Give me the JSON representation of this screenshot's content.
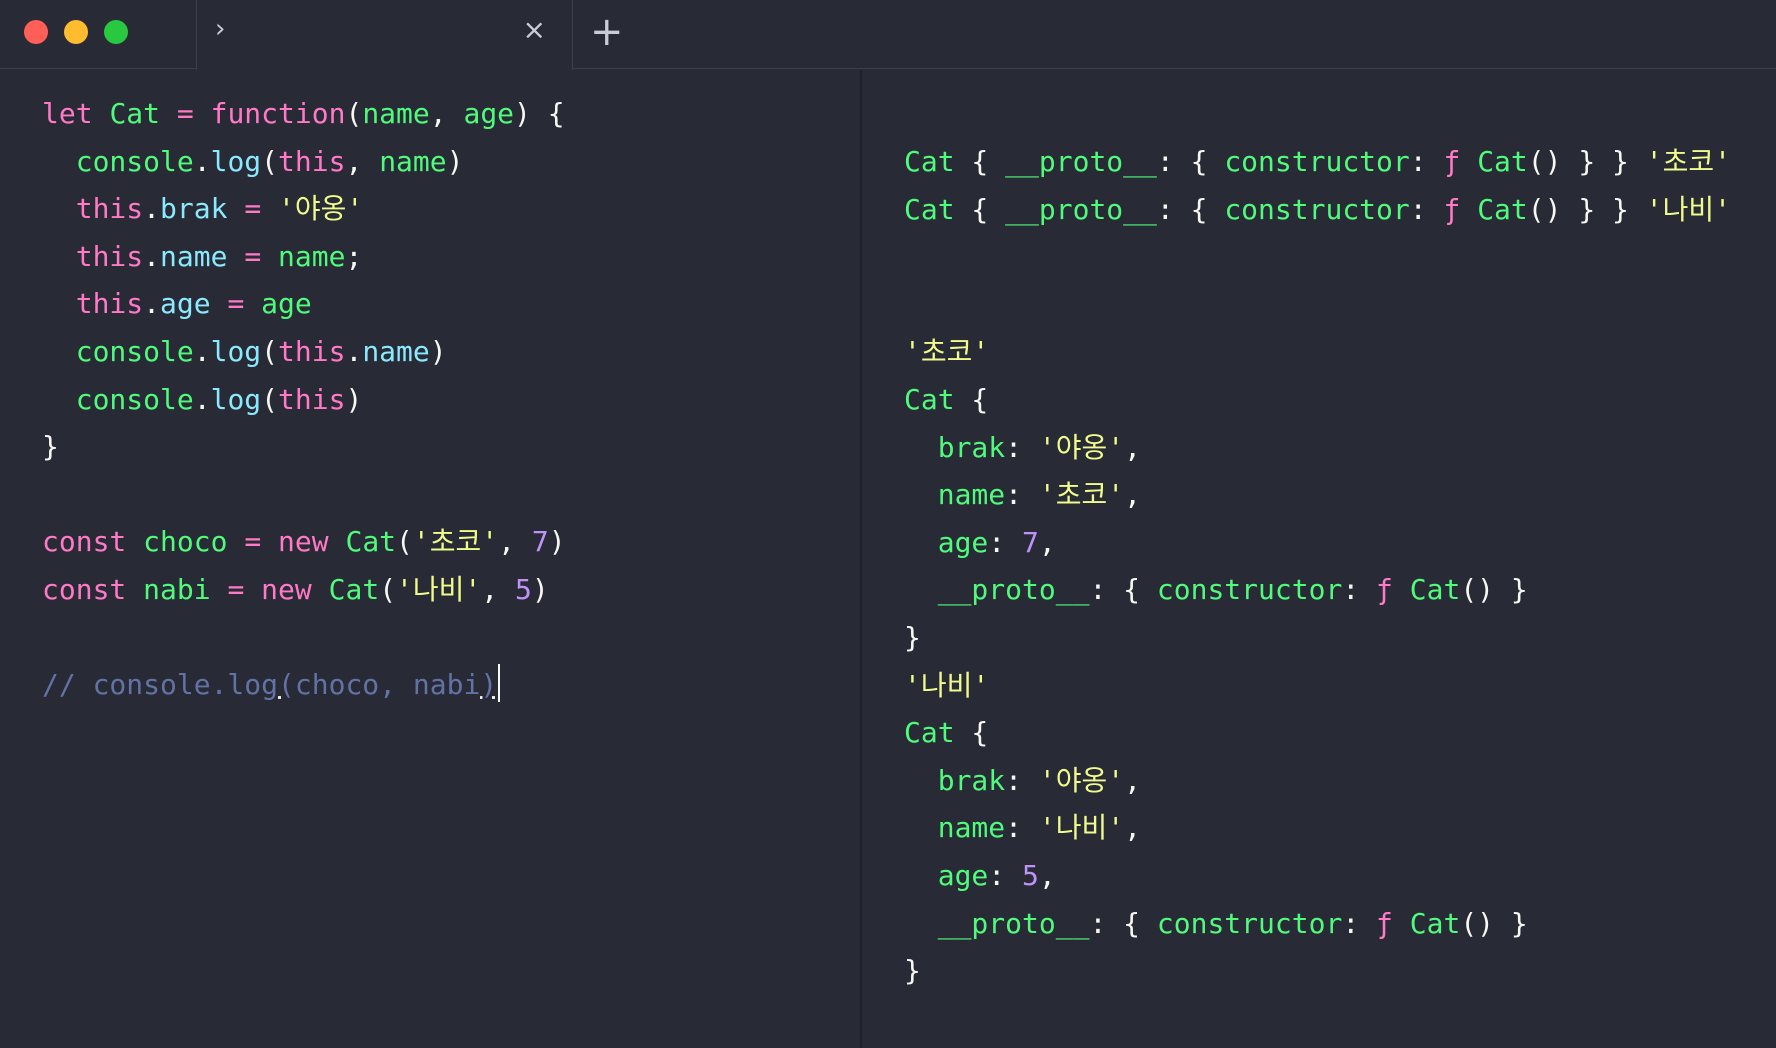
{
  "window": {
    "tab": {
      "chevron": "›",
      "close": "×"
    },
    "new_tab": "+"
  },
  "editor": {
    "lines": [
      [
        {
          "t": "let",
          "c": "k"
        },
        {
          "t": " "
        },
        {
          "t": "Cat",
          "c": "f"
        },
        {
          "t": " "
        },
        {
          "t": "=",
          "c": "k"
        },
        {
          "t": " "
        },
        {
          "t": "function",
          "c": "k"
        },
        {
          "t": "("
        },
        {
          "t": "name",
          "c": "f"
        },
        {
          "t": ", "
        },
        {
          "t": "age",
          "c": "f"
        },
        {
          "t": ") {"
        }
      ],
      [
        {
          "t": "  "
        },
        {
          "t": "console",
          "c": "f"
        },
        {
          "t": "."
        },
        {
          "t": "log",
          "c": "p"
        },
        {
          "t": "("
        },
        {
          "t": "this",
          "c": "k"
        },
        {
          "t": ", "
        },
        {
          "t": "name",
          "c": "f"
        },
        {
          "t": ")"
        }
      ],
      [
        {
          "t": "  "
        },
        {
          "t": "this",
          "c": "k"
        },
        {
          "t": "."
        },
        {
          "t": "brak",
          "c": "p"
        },
        {
          "t": " "
        },
        {
          "t": "=",
          "c": "k"
        },
        {
          "t": " "
        },
        {
          "t": "'야옹'",
          "c": "s"
        }
      ],
      [
        {
          "t": "  "
        },
        {
          "t": "this",
          "c": "k"
        },
        {
          "t": "."
        },
        {
          "t": "name",
          "c": "p"
        },
        {
          "t": " "
        },
        {
          "t": "=",
          "c": "k"
        },
        {
          "t": " "
        },
        {
          "t": "name",
          "c": "f"
        },
        {
          "t": ";"
        }
      ],
      [
        {
          "t": "  "
        },
        {
          "t": "this",
          "c": "k"
        },
        {
          "t": "."
        },
        {
          "t": "age",
          "c": "p"
        },
        {
          "t": " "
        },
        {
          "t": "=",
          "c": "k"
        },
        {
          "t": " "
        },
        {
          "t": "age",
          "c": "f"
        }
      ],
      [
        {
          "t": "  "
        },
        {
          "t": "console",
          "c": "f"
        },
        {
          "t": "."
        },
        {
          "t": "log",
          "c": "p"
        },
        {
          "t": "("
        },
        {
          "t": "this",
          "c": "k"
        },
        {
          "t": "."
        },
        {
          "t": "name",
          "c": "p"
        },
        {
          "t": ")"
        }
      ],
      [
        {
          "t": "  "
        },
        {
          "t": "console",
          "c": "f"
        },
        {
          "t": "."
        },
        {
          "t": "log",
          "c": "p"
        },
        {
          "t": "("
        },
        {
          "t": "this",
          "c": "k"
        },
        {
          "t": ")"
        }
      ],
      [
        {
          "t": "}"
        }
      ],
      [],
      [
        {
          "t": "const",
          "c": "k"
        },
        {
          "t": " "
        },
        {
          "t": "choco",
          "c": "f"
        },
        {
          "t": " "
        },
        {
          "t": "=",
          "c": "k"
        },
        {
          "t": " "
        },
        {
          "t": "new",
          "c": "k"
        },
        {
          "t": " "
        },
        {
          "t": "Cat",
          "c": "f"
        },
        {
          "t": "("
        },
        {
          "t": "'초코'",
          "c": "s"
        },
        {
          "t": ", "
        },
        {
          "t": "7",
          "c": "n"
        },
        {
          "t": ")"
        }
      ],
      [
        {
          "t": "const",
          "c": "k"
        },
        {
          "t": " "
        },
        {
          "t": "nabi",
          "c": "f"
        },
        {
          "t": " "
        },
        {
          "t": "=",
          "c": "k"
        },
        {
          "t": " "
        },
        {
          "t": "new",
          "c": "k"
        },
        {
          "t": " "
        },
        {
          "t": "Cat",
          "c": "f"
        },
        {
          "t": "("
        },
        {
          "t": "'나비'",
          "c": "s"
        },
        {
          "t": ", "
        },
        {
          "t": "5",
          "c": "n"
        },
        {
          "t": ")"
        }
      ],
      [],
      [
        {
          "t": "// console.log",
          "c": "c"
        },
        {
          "t": "(",
          "c": "c bracket-hl"
        },
        {
          "t": "choco, nabi",
          "c": "c"
        },
        {
          "t": ")",
          "c": "c bracket-hl"
        },
        {
          "cursor": true
        }
      ]
    ]
  },
  "output": {
    "lines": [
      [
        {
          "t": "Cat",
          "c": "f"
        },
        {
          "t": " { "
        },
        {
          "t": "__proto__",
          "c": "f"
        },
        {
          "t": ": { "
        },
        {
          "t": "constructor",
          "c": "f"
        },
        {
          "t": ": "
        },
        {
          "t": "ƒ",
          "c": "k"
        },
        {
          "t": " "
        },
        {
          "t": "Cat",
          "c": "f"
        },
        {
          "t": "() } } "
        },
        {
          "t": "'초코'",
          "c": "s"
        }
      ],
      [
        {
          "t": "Cat",
          "c": "f"
        },
        {
          "t": " { "
        },
        {
          "t": "__proto__",
          "c": "f"
        },
        {
          "t": ": { "
        },
        {
          "t": "constructor",
          "c": "f"
        },
        {
          "t": ": "
        },
        {
          "t": "ƒ",
          "c": "k"
        },
        {
          "t": " "
        },
        {
          "t": "Cat",
          "c": "f"
        },
        {
          "t": "() } } "
        },
        {
          "t": "'나비'",
          "c": "s"
        }
      ],
      [],
      [],
      [
        {
          "t": "'초코'",
          "c": "s"
        }
      ],
      [
        {
          "t": "Cat",
          "c": "f"
        },
        {
          "t": " {"
        }
      ],
      [
        {
          "t": "  "
        },
        {
          "t": "brak",
          "c": "f"
        },
        {
          "t": ": "
        },
        {
          "t": "'야옹'",
          "c": "s"
        },
        {
          "t": ","
        }
      ],
      [
        {
          "t": "  "
        },
        {
          "t": "name",
          "c": "f"
        },
        {
          "t": ": "
        },
        {
          "t": "'초코'",
          "c": "s"
        },
        {
          "t": ","
        }
      ],
      [
        {
          "t": "  "
        },
        {
          "t": "age",
          "c": "f"
        },
        {
          "t": ": "
        },
        {
          "t": "7",
          "c": "n"
        },
        {
          "t": ","
        }
      ],
      [
        {
          "t": "  "
        },
        {
          "t": "__proto__",
          "c": "f"
        },
        {
          "t": ": { "
        },
        {
          "t": "constructor",
          "c": "f"
        },
        {
          "t": ": "
        },
        {
          "t": "ƒ",
          "c": "k"
        },
        {
          "t": " "
        },
        {
          "t": "Cat",
          "c": "f"
        },
        {
          "t": "() }"
        }
      ],
      [
        {
          "t": "}"
        }
      ],
      [
        {
          "t": "'나비'",
          "c": "s"
        }
      ],
      [
        {
          "t": "Cat",
          "c": "f"
        },
        {
          "t": " {"
        }
      ],
      [
        {
          "t": "  "
        },
        {
          "t": "brak",
          "c": "f"
        },
        {
          "t": ": "
        },
        {
          "t": "'야옹'",
          "c": "s"
        },
        {
          "t": ","
        }
      ],
      [
        {
          "t": "  "
        },
        {
          "t": "name",
          "c": "f"
        },
        {
          "t": ": "
        },
        {
          "t": "'나비'",
          "c": "s"
        },
        {
          "t": ","
        }
      ],
      [
        {
          "t": "  "
        },
        {
          "t": "age",
          "c": "f"
        },
        {
          "t": ": "
        },
        {
          "t": "5",
          "c": "n"
        },
        {
          "t": ","
        }
      ],
      [
        {
          "t": "  "
        },
        {
          "t": "__proto__",
          "c": "f"
        },
        {
          "t": ": { "
        },
        {
          "t": "constructor",
          "c": "f"
        },
        {
          "t": ": "
        },
        {
          "t": "ƒ",
          "c": "k"
        },
        {
          "t": " "
        },
        {
          "t": "Cat",
          "c": "f"
        },
        {
          "t": "() }"
        }
      ],
      [
        {
          "t": "}"
        }
      ]
    ]
  }
}
